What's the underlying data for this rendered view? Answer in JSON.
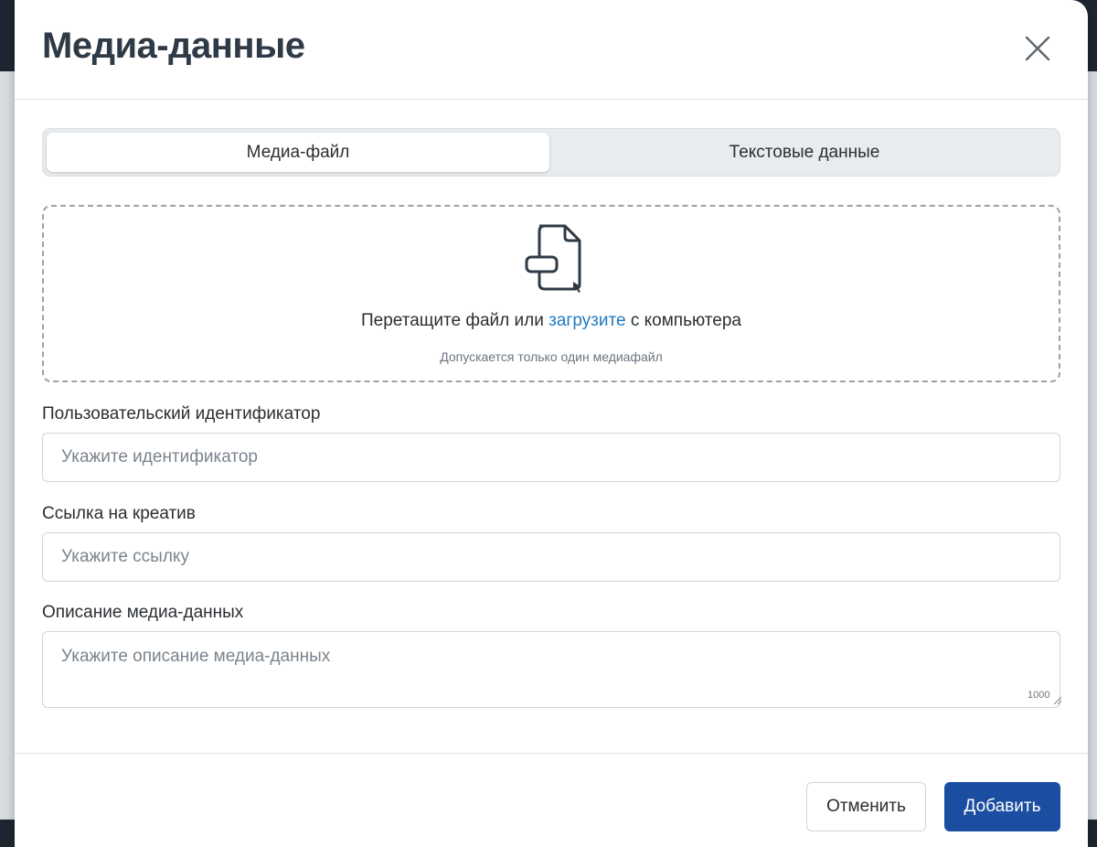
{
  "modal": {
    "title": "Медиа-данные"
  },
  "tabs": [
    {
      "label": "Медиа-файл",
      "active": true
    },
    {
      "label": "Текстовые данные",
      "active": false
    }
  ],
  "dropzone": {
    "text_before": "Перетащите файл или ",
    "link_text": "загрузите",
    "text_after": " с компьютера",
    "hint": "Допускается только один медиафайл",
    "icon": "file-upload-icon"
  },
  "fields": {
    "custom_id": {
      "label": "Пользовательский идентификатор",
      "placeholder": "Укажите идентификатор",
      "value": ""
    },
    "creative_link": {
      "label": "Ссылка на креатив",
      "placeholder": "Укажите ссылку",
      "value": ""
    },
    "description": {
      "label": "Описание медиа-данных",
      "placeholder": "Укажите описание медиа-данных",
      "value": "",
      "counter": "1000"
    }
  },
  "footer": {
    "cancel_label": "Отменить",
    "add_label": "Добавить"
  },
  "colors": {
    "accent": "#1b4ea1",
    "link": "#1f7bc1",
    "title": "#2f3a47"
  }
}
